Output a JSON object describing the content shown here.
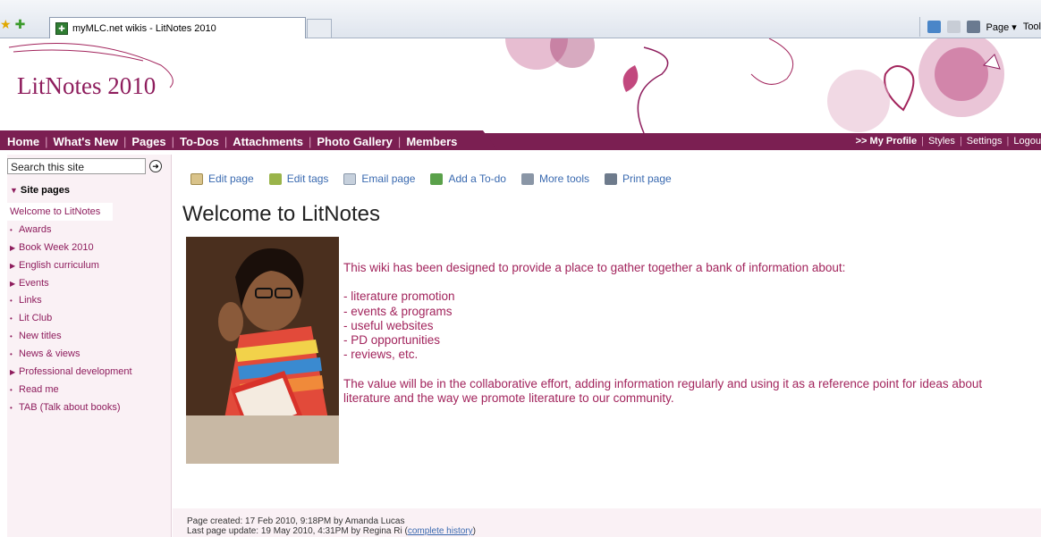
{
  "browser": {
    "tab_title": "myMLC.net wikis - LitNotes 2010",
    "commands": [
      "Page ▾",
      "Tool"
    ]
  },
  "site": {
    "title": "LitNotes 2010"
  },
  "nav": {
    "main": [
      "Home",
      "What's New",
      "Pages",
      "To-Dos",
      "Attachments",
      "Photo Gallery",
      "Members"
    ],
    "right": [
      ">> My Profile",
      "Styles",
      "Settings",
      "Logou"
    ]
  },
  "sidebar": {
    "search_placeholder": "Search this site",
    "section_title": "Site pages",
    "items": [
      {
        "label": "Welcome to LitNotes",
        "marker": ""
      },
      {
        "label": "Awards",
        "marker": "•"
      },
      {
        "label": "Book Week 2010",
        "marker": "▶"
      },
      {
        "label": "English curriculum",
        "marker": "▶"
      },
      {
        "label": "Events",
        "marker": "▶"
      },
      {
        "label": "Links",
        "marker": "•"
      },
      {
        "label": "Lit Club",
        "marker": "•"
      },
      {
        "label": "New titles",
        "marker": "•"
      },
      {
        "label": "News & views",
        "marker": "•"
      },
      {
        "label": "Professional development",
        "marker": "▶"
      },
      {
        "label": "Read me",
        "marker": "•"
      },
      {
        "label": "TAB (Talk about books)",
        "marker": "•"
      }
    ]
  },
  "toolbar": {
    "edit_page": "Edit page",
    "edit_tags": "Edit tags",
    "email_page": "Email page",
    "add_todo": "Add a To-do",
    "more_tools": "More tools",
    "print_page": "Print page"
  },
  "page": {
    "title": "Welcome to LitNotes",
    "intro": "This wiki has been designed to provide a place to gather together a bank of information about:",
    "list": [
      "- literature promotion",
      "- events & programs",
      "- useful websites",
      "- PD opportunities",
      "- reviews, etc."
    ],
    "closing": "The value will be in the collaborative effort, adding information regularly and using it as a reference point for ideas about literature and the way we promote literature to our community.",
    "created": "Page created: 17 Feb 2010, 9:18PM by Amanda Lucas",
    "updated_prefix": "Last page update: 19 May 2010, 4:31PM by Regina Ri (",
    "history_link": "complete history",
    "updated_suffix": ")"
  },
  "colors": {
    "brand": "#7b1f52",
    "accent_text": "#a2245c",
    "link": "#3a6ab0"
  }
}
